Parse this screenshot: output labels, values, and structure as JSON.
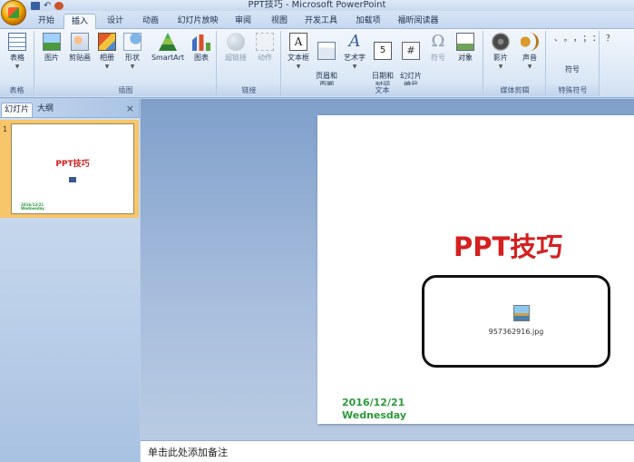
{
  "window": {
    "title": "PPT技巧 - Microsoft PowerPoint"
  },
  "quick_access": {
    "undo_icon": "↶"
  },
  "tabs": [
    {
      "label": "开始",
      "active": false
    },
    {
      "label": "插入",
      "active": true
    },
    {
      "label": "设计",
      "active": false
    },
    {
      "label": "动画",
      "active": false
    },
    {
      "label": "幻灯片放映",
      "active": false
    },
    {
      "label": "审阅",
      "active": false
    },
    {
      "label": "视图",
      "active": false
    },
    {
      "label": "开发工具",
      "active": false
    },
    {
      "label": "加载项",
      "active": false
    },
    {
      "label": "福昕阅读器",
      "active": false
    }
  ],
  "ribbon": {
    "groups": {
      "table": {
        "label": "表格",
        "buttons": {
          "table": "表格"
        }
      },
      "illustrations": {
        "label": "插图",
        "buttons": {
          "picture": "图片",
          "clipart": "剪贴画",
          "album": "相册",
          "shapes": "形状",
          "smartart": "SmartArt",
          "chart": "图表"
        }
      },
      "links": {
        "label": "链接",
        "buttons": {
          "hyperlink": "超链接",
          "action": "动作"
        }
      },
      "text": {
        "label": "文本",
        "buttons": {
          "textbox": "文本框",
          "header_footer": "页眉和\n页脚",
          "wordart": "艺术字",
          "datetime": "日期和\n时间",
          "slide_number": "幻灯片\n编号",
          "symbol": "符号",
          "object": "对象"
        }
      },
      "media": {
        "label": "媒体剪辑",
        "buttons": {
          "movie": "影片",
          "sound": "声音"
        }
      },
      "special": {
        "label": "特殊符号",
        "buttons": {
          "symbol": "符号"
        },
        "symbols": "、。，；：？"
      }
    },
    "icons": {
      "textbox_glyph": "A",
      "wordart_glyph": "A",
      "date_glyph": "5",
      "slidenum_glyph": "#",
      "omega_glyph": "Ω"
    }
  },
  "left_panel": {
    "tabs": [
      {
        "label": "幻灯片",
        "active": true
      },
      {
        "label": "大纲",
        "active": false
      }
    ],
    "close": "×",
    "thumbnail": {
      "number": "1",
      "title": "PPT技巧",
      "date": "2016/12/21",
      "weekday": "Wednesday"
    }
  },
  "slide": {
    "title": "PPT技巧",
    "image_filename": "957362916.jpg",
    "date": "2016/12/21",
    "weekday": "Wednesday"
  },
  "notes": {
    "placeholder": "单击此处添加备注"
  }
}
